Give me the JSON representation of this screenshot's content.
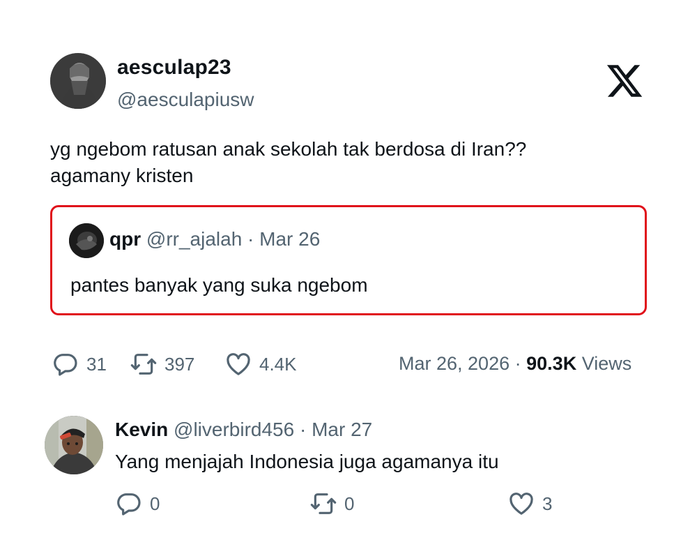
{
  "author": {
    "display_name": "aesculap23",
    "handle": "@aesculapiusw"
  },
  "logo_icon": "x-logo-icon",
  "tweet": {
    "lines": [
      "yg ngebom ratusan anak sekolah tak berdosa di Iran??",
      "agamany kristen"
    ]
  },
  "quote": {
    "name": "qpr",
    "handle": "@rr_ajalah",
    "separator": "·",
    "date": "Mar 26",
    "text": "pantes banyak yang suka ngebom",
    "highlight_color": "#e0101a"
  },
  "stats": {
    "replies": "31",
    "reposts": "397",
    "likes": "4.4K"
  },
  "meta": {
    "date": "Mar 26, 2026",
    "separator": "·",
    "views": "90.3K",
    "views_label": "Views"
  },
  "reply": {
    "name": "Kevin",
    "handle": "@liverbird456",
    "separator": "·",
    "date": "Mar 27",
    "text": "Yang menjajah Indonesia juga agamanya itu",
    "stats": {
      "replies": "0",
      "reposts": "0",
      "likes": "3"
    }
  },
  "icons": {
    "reply": "speech-bubble-icon",
    "repost": "repost-arrows-icon",
    "like": "heart-icon"
  },
  "colors": {
    "text_primary": "#0f1419",
    "text_secondary": "#536471"
  }
}
